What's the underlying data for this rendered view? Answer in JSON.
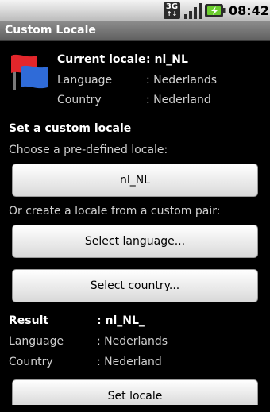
{
  "status_bar": {
    "network": "3G",
    "time": "08:42"
  },
  "title_bar": {
    "title": "Custom Locale"
  },
  "current": {
    "heading": "Current locale",
    "value": ": nl_NL",
    "language_label": "Language",
    "language_value": ": Nederlands",
    "country_label": "Country",
    "country_value": ": Nederland"
  },
  "custom": {
    "heading": "Set a custom locale",
    "predefined_prompt": "Choose a pre-defined locale:",
    "predefined_button": "nl_NL",
    "custom_pair_prompt": "Or create a locale from a custom pair:",
    "select_language_button": "Select language...",
    "select_country_button": "Select country..."
  },
  "result": {
    "heading": "Result",
    "value": ": nl_NL_",
    "language_label": "Language",
    "language_value": ": Nederlands",
    "country_label": "Country",
    "country_value": ": Nederland"
  },
  "set_locale_button": "Set locale"
}
